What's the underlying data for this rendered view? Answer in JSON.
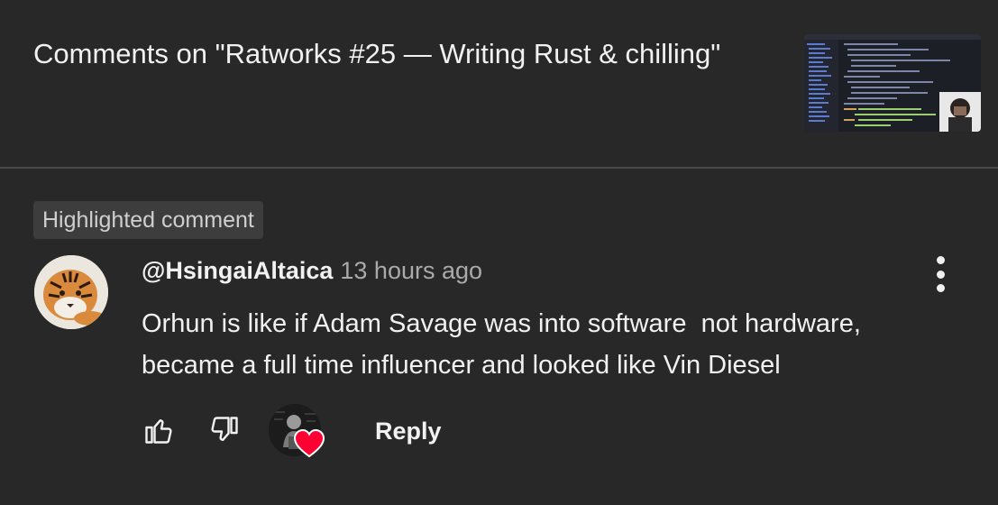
{
  "header": {
    "title": "Comments on \"Ratworks #25 — Writing Rust & chilling\""
  },
  "highlight": {
    "label": "Highlighted comment"
  },
  "comment": {
    "author": "@HsingaiAltaica",
    "time": "13 hours ago",
    "text_lines": [
      "Orhun is like if Adam Savage was into software  not hardware,",
      "became a full time influencer and looked like Vin Diesel"
    ]
  },
  "actions": {
    "reply_label": "Reply"
  },
  "icons": {
    "like": "thumbs-up-icon",
    "dislike": "thumbs-down-icon",
    "more": "more-vert-icon",
    "heart": "heart-icon"
  },
  "colors": {
    "background": "#282828",
    "heart": "#ff0033",
    "secondary_text": "#aaaaaa"
  }
}
